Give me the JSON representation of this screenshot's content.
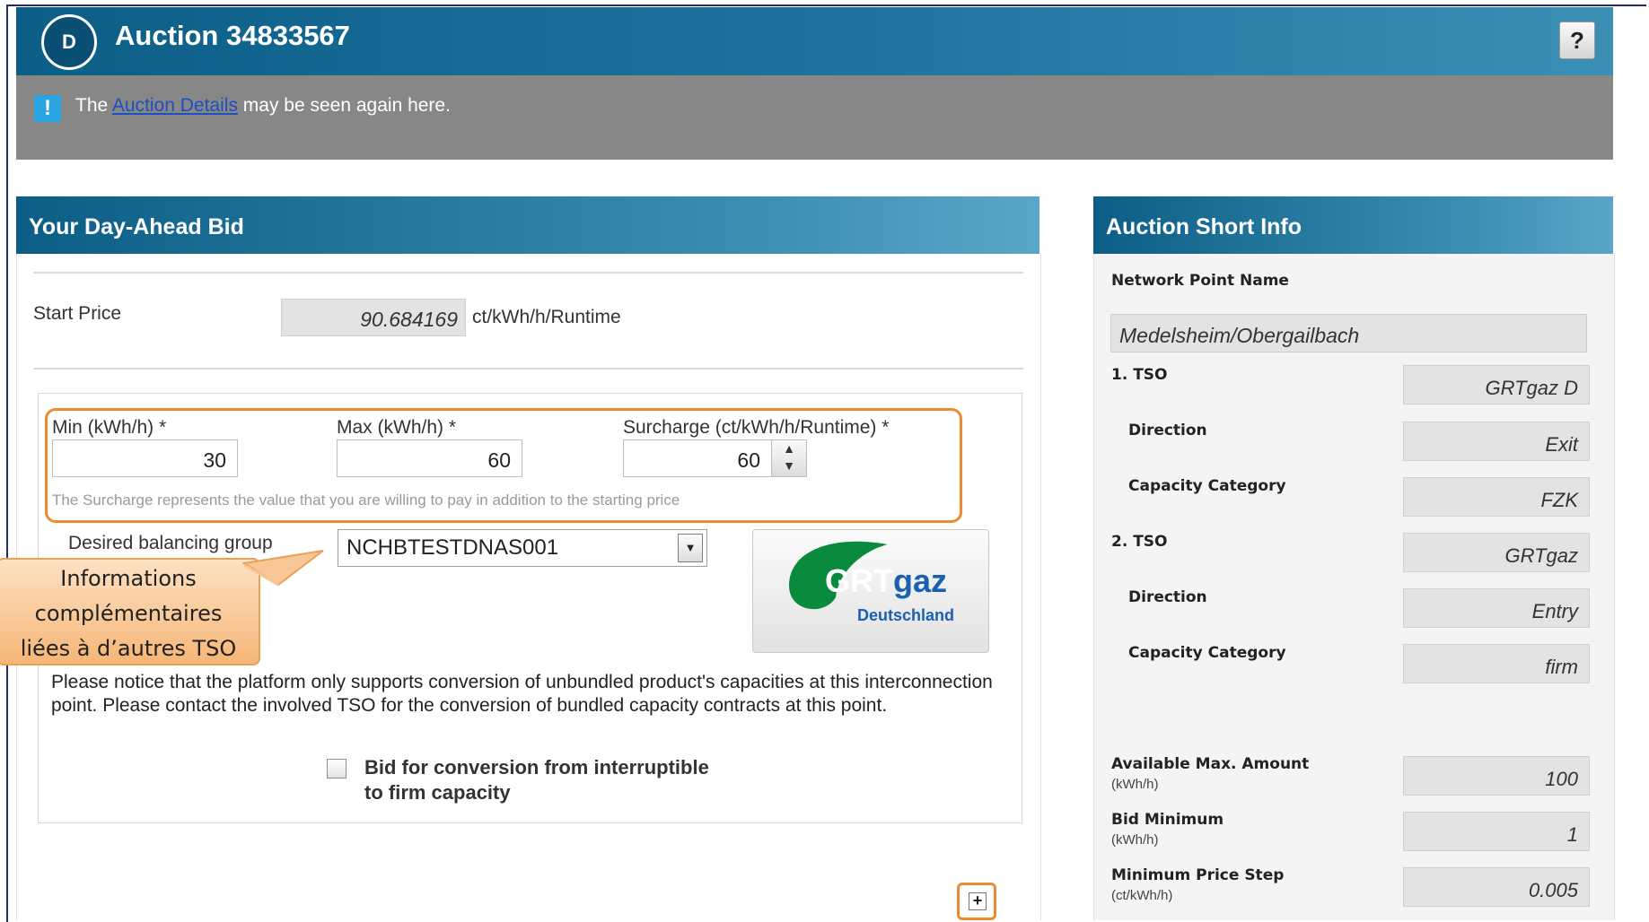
{
  "header": {
    "badge": "D",
    "title": "Auction 34833567",
    "help_label": "?"
  },
  "info_bar": {
    "icon": "!",
    "text_before": "The ",
    "link": "Auction Details",
    "text_after": " may be seen again here."
  },
  "bid_panel": {
    "title": "Your Day-Ahead Bid",
    "start_price_label": "Start Price",
    "start_price_value": "90.684169",
    "start_price_unit": "ct/kWh/h/Runtime",
    "min_label": "Min (kWh/h) *",
    "min_value": "30",
    "max_label": "Max (kWh/h) *",
    "max_value": "60",
    "surcharge_label": "Surcharge (ct/kWh/h/Runtime) *",
    "surcharge_value": "60",
    "surcharge_hint": "The Surcharge represents the value that you are willing to pay in addition to the starting price",
    "balancing_label": "Desired balancing group",
    "balancing_value": "NCHBTESTDNAS001",
    "logo": {
      "main": "GRT",
      "suffix": "gaz",
      "sub": "Deutschland"
    },
    "notice": "Please notice that the platform only supports conversion of unbundled product's capacities at this interconnection point. Please contact the involved TSO for the conversion of bundled capacity contracts at this point.",
    "conversion_line1": "Bid for conversion from interruptible",
    "conversion_line2": "to firm capacity",
    "add_label": "+"
  },
  "callout": {
    "line1": "Informations",
    "line2": "complémentaires",
    "line3": "liées à d’autres TSO"
  },
  "short_info": {
    "title": "Auction Short Info",
    "network_point_label": "Network Point Name",
    "network_point_value": "Medelsheim/Obergailbach",
    "tso1_label": "1. TSO",
    "tso1_value": "GRTgaz D",
    "tso1_direction_label": "Direction",
    "tso1_direction_value": "Exit",
    "tso1_category_label": "Capacity Category",
    "tso1_category_value": "FZK",
    "tso2_label": "2. TSO",
    "tso2_value": "GRTgaz",
    "tso2_direction_label": "Direction",
    "tso2_direction_value": "Entry",
    "tso2_category_label": "Capacity Category",
    "tso2_category_value": "firm",
    "avail_label": "Available Max. Amount",
    "avail_unit": "(kWh/h)",
    "avail_value": "100",
    "bidmin_label": "Bid Minimum",
    "bidmin_unit": "(kWh/h)",
    "bidmin_value": "1",
    "step_label": "Minimum Price Step",
    "step_unit": "(ct/kWh/h)",
    "step_value": "0.005"
  },
  "colors": {
    "header_blue": "#0c5e86",
    "info_grey": "#878787",
    "highlight_orange": "#ef8a2e",
    "logo_green": "#0a8a3c",
    "logo_blue": "#1a5fb0"
  }
}
